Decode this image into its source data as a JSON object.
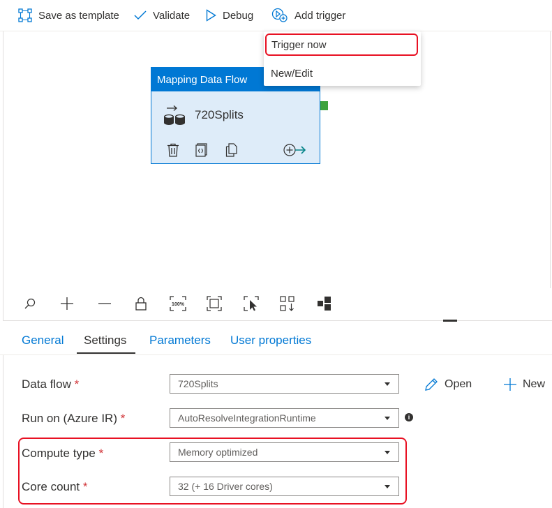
{
  "toolbar": {
    "save_template_label": "Save as template",
    "validate_label": "Validate",
    "debug_label": "Debug",
    "add_trigger_label": "Add trigger"
  },
  "trigger_menu": {
    "items": [
      {
        "label": "Trigger now",
        "highlighted": true
      },
      {
        "label": "New/Edit",
        "highlighted": false
      }
    ]
  },
  "activity": {
    "type_label": "Mapping Data Flow",
    "name": "720Splits"
  },
  "canvas_controls": {
    "zoom_label": "100%"
  },
  "tabs": [
    {
      "label": "General",
      "active": false
    },
    {
      "label": "Settings",
      "active": true
    },
    {
      "label": "Parameters",
      "active": false
    },
    {
      "label": "User properties",
      "active": false
    }
  ],
  "settings": {
    "data_flow": {
      "label": "Data flow",
      "required_mark": "*",
      "value": "720Splits"
    },
    "run_on": {
      "label": "Run on (Azure IR)",
      "required_mark": "*",
      "value": "AutoResolveIntegrationRuntime",
      "info_glyph": "i"
    },
    "compute_type": {
      "label": "Compute type",
      "required_mark": "*",
      "value": "Memory optimized"
    },
    "core_count": {
      "label": "Core count",
      "required_mark": "*",
      "value": "32 (+ 16 Driver cores)"
    },
    "open_label": "Open",
    "new_label": "New"
  },
  "colors": {
    "accent": "#0078d4",
    "card_fill": "#deecf9",
    "highlight_border": "#e81123",
    "required": "#d13438",
    "handle": "#3da33d"
  }
}
